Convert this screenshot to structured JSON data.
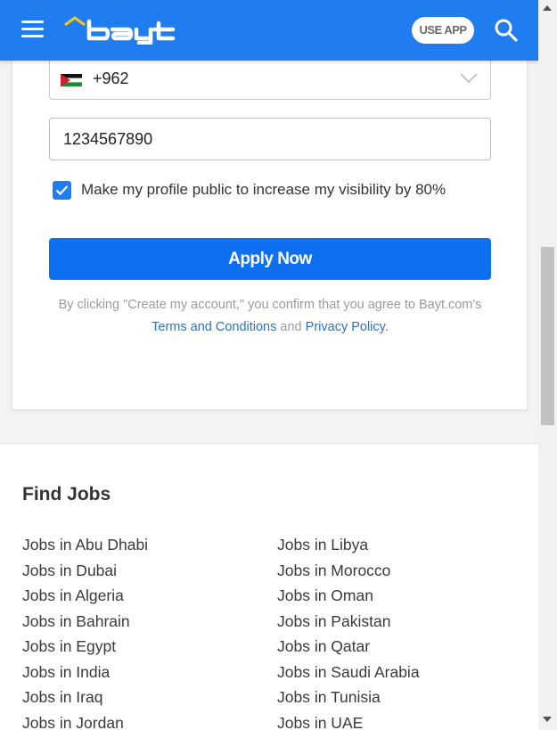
{
  "header": {
    "use_app_label": "USE APP",
    "brand_color": "#1f7df0"
  },
  "form": {
    "country_code": "+962",
    "country_flag": "jordan-flag-icon",
    "phone_value": "1234567890",
    "visibility_checked": true,
    "visibility_label": "Make my profile public to increase my visibility by 80%",
    "apply_label": "Apply Now",
    "legal_prefix": "By clicking \"Create my account,\" you confirm that you agree to Bayt.com's",
    "terms_link": "Terms and Conditions",
    "legal_and": "and",
    "privacy_link": "Privacy Policy.",
    "accent_color": "#0e6ff0"
  },
  "find_jobs": {
    "title": "Find Jobs",
    "left": [
      {
        "label": "Jobs in Abu Dhabi"
      },
      {
        "label": "Jobs in Dubai"
      },
      {
        "label": "Jobs in Algeria"
      },
      {
        "label": "Jobs in Bahrain"
      },
      {
        "label": "Jobs in Egypt"
      },
      {
        "label": "Jobs in India"
      },
      {
        "label": "Jobs in Iraq"
      },
      {
        "label": "Jobs in Jordan"
      }
    ],
    "right": [
      {
        "label": "Jobs in Libya"
      },
      {
        "label": "Jobs in Morocco"
      },
      {
        "label": "Jobs in Oman"
      },
      {
        "label": "Jobs in Pakistan"
      },
      {
        "label": "Jobs in Qatar"
      },
      {
        "label": "Jobs in Saudi Arabia"
      },
      {
        "label": "Jobs in Tunisia"
      },
      {
        "label": "Jobs in UAE"
      }
    ]
  }
}
